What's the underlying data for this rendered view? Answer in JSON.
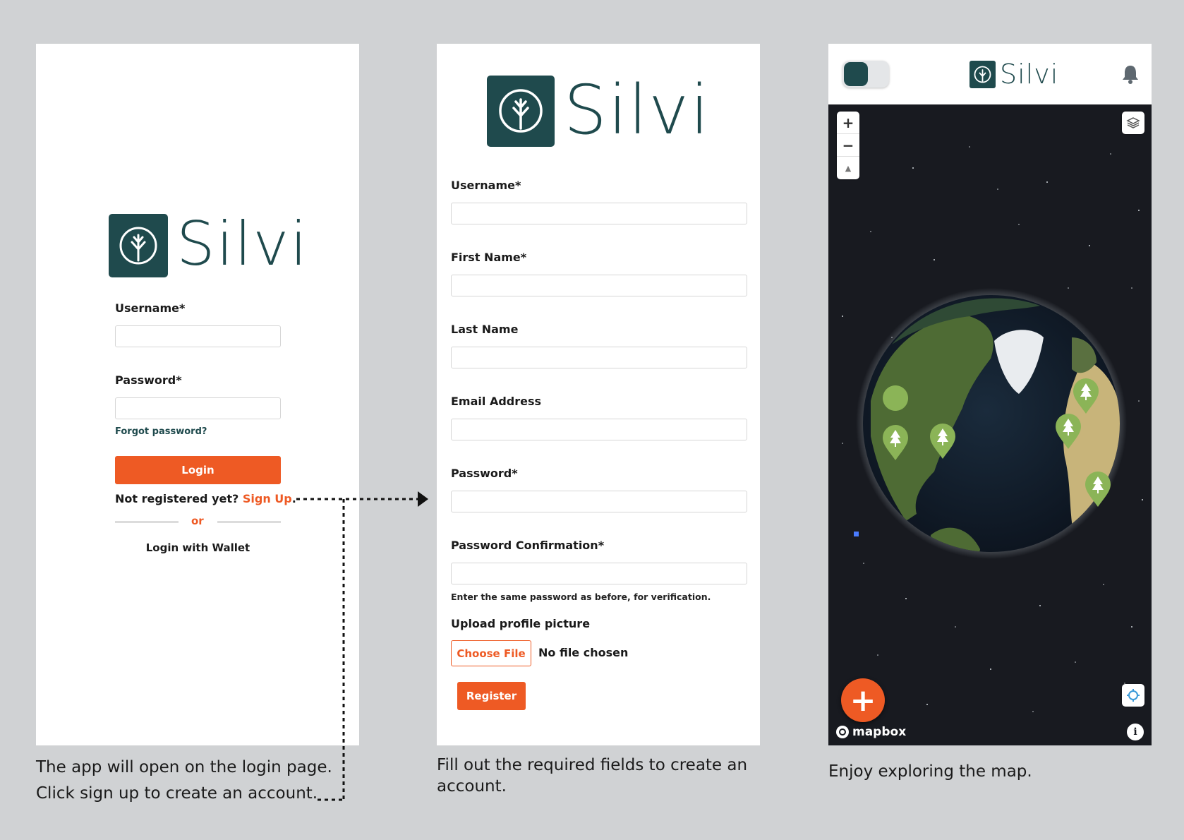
{
  "login": {
    "brand": "Silvi",
    "username_label": "Username*",
    "password_label": "Password*",
    "forgot_password": "Forgot password?",
    "login_button": "Login",
    "not_registered": "Not registered yet?",
    "sign_up": "Sign Up",
    "period": ".",
    "or": "or",
    "wallet_login": "Login with Wallet"
  },
  "register": {
    "brand": "Silvi",
    "username_label": "Username*",
    "first_name_label": "First Name*",
    "last_name_label": "Last Name",
    "email_label": "Email Address",
    "password_label": "Password*",
    "password_confirm_label": "Password Confirmation*",
    "password_help": "Enter the same password as before, for verification.",
    "upload_label": "Upload profile picture",
    "choose_file": "Choose File",
    "no_file": "No file chosen",
    "register_button": "Register"
  },
  "map": {
    "brand": "Silvi",
    "zoom_in": "+",
    "zoom_out": "−",
    "compass": "▲",
    "fab": "+",
    "attribution": "mapbox",
    "info": "i"
  },
  "captions": {
    "login_line1": "The app will open on the login page.",
    "login_line2": "Click sign up to create an account.",
    "register": "Fill out the required fields to create an account.",
    "map": "Enjoy exploring the map."
  },
  "colors": {
    "brand_teal": "#1f4a4d",
    "accent_orange": "#ee5a24",
    "marker_green": "#8bb457",
    "background": "#d0d2d4"
  },
  "icons": {
    "logo": "tree-circle-icon",
    "bell": "bell-icon",
    "layers": "layers-icon",
    "locate": "locate-icon",
    "marker": "tree-marker-icon",
    "info": "info-icon",
    "mapbox": "mapbox-logo-icon"
  }
}
